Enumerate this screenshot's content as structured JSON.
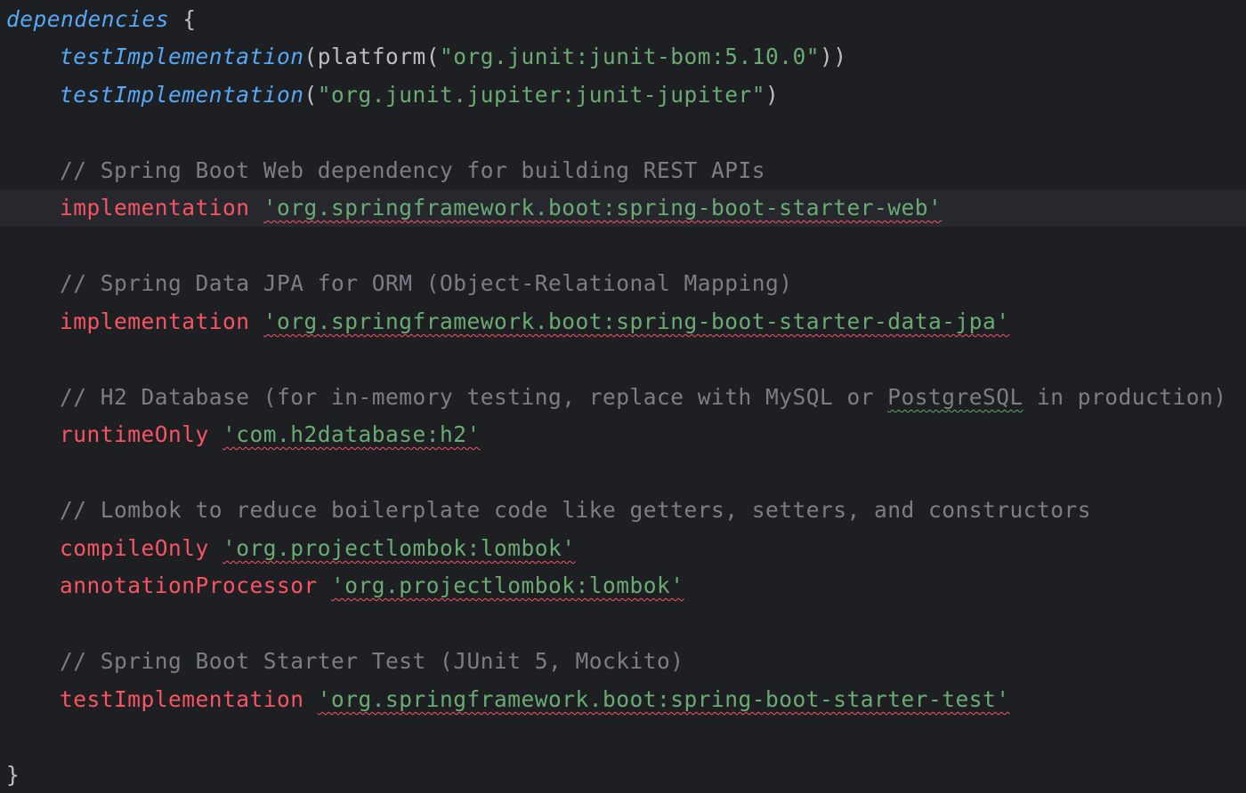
{
  "editor": {
    "colors": {
      "background": "#1e1f22",
      "current_line": "#26282e",
      "function_call": "#56a8f5",
      "string": "#6aab73",
      "configuration_keyword": "#f75464",
      "comment": "#7a7e85",
      "plain_text": "#bcbec4",
      "error_squiggle": "#f75464"
    },
    "lines": {
      "dependencies_open": {
        "keyword": "dependencies",
        "brace": " {"
      },
      "junit_bom": {
        "func": "testImplementation",
        "open": "(platform(",
        "value": "\"org.junit:junit-bom:5.10.0\"",
        "close": "))"
      },
      "junit_jupiter": {
        "func": "testImplementation",
        "open": "(",
        "value": "\"org.junit.jupiter:junit-jupiter\"",
        "close": ")"
      },
      "comment_web": "// Spring Boot Web dependency for building REST APIs",
      "dep_web": {
        "config": "implementation",
        "value": "'org.springframework.boot:spring-boot-starter-web'"
      },
      "comment_jpa": "// Spring Data JPA for ORM (Object-Relational Mapping)",
      "dep_jpa": {
        "config": "implementation",
        "value": "'org.springframework.boot:spring-boot-starter-data-jpa'"
      },
      "comment_h2": {
        "before": "// H2 Database (for in-memory testing, replace with MySQL or ",
        "flagged_word": "PostgreSQL",
        "after": " in production)"
      },
      "dep_h2": {
        "config": "runtimeOnly",
        "value": "'com.h2database:h2'"
      },
      "comment_lombok": "// Lombok to reduce boilerplate code like getters, setters, and constructors",
      "dep_lombok_compile": {
        "config": "compileOnly",
        "value": "'org.projectlombok:lombok'"
      },
      "dep_lombok_annotation": {
        "config": "annotationProcessor",
        "value": "'org.projectlombok:lombok'"
      },
      "comment_test": "// Spring Boot Starter Test (JUnit 5, Mockito)",
      "dep_test": {
        "config": "testImplementation",
        "value": "'org.springframework.boot:spring-boot-starter-test'"
      },
      "dependencies_close": "}"
    }
  }
}
